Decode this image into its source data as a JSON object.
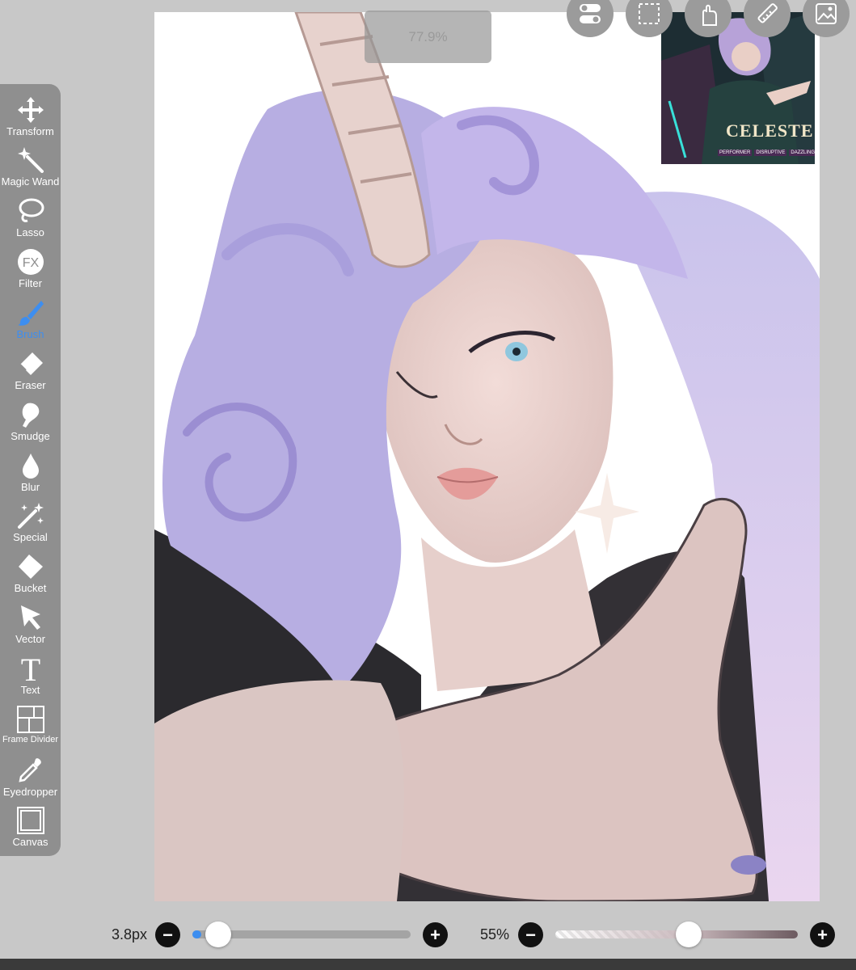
{
  "zoom": {
    "level": "77.9%"
  },
  "toolbar": {
    "active": "Brush",
    "tools": [
      {
        "id": "transform",
        "label": "Transform",
        "icon": "move-arrows-icon"
      },
      {
        "id": "magic-wand",
        "label": "Magic Wand",
        "icon": "magic-wand-icon"
      },
      {
        "id": "lasso",
        "label": "Lasso",
        "icon": "lasso-icon"
      },
      {
        "id": "filter",
        "label": "Filter",
        "icon": "fx-icon"
      },
      {
        "id": "brush",
        "label": "Brush",
        "icon": "brush-icon"
      },
      {
        "id": "eraser",
        "label": "Eraser",
        "icon": "eraser-icon"
      },
      {
        "id": "smudge",
        "label": "Smudge",
        "icon": "smudge-finger-icon"
      },
      {
        "id": "blur",
        "label": "Blur",
        "icon": "droplet-icon"
      },
      {
        "id": "special",
        "label": "Special",
        "icon": "sparkle-wand-icon"
      },
      {
        "id": "bucket",
        "label": "Bucket",
        "icon": "bucket-icon"
      },
      {
        "id": "vector",
        "label": "Vector",
        "icon": "cursor-arrow-icon"
      },
      {
        "id": "text",
        "label": "Text",
        "icon": "text-t-icon"
      },
      {
        "id": "frame-divider",
        "label": "Frame Divider",
        "icon": "frame-divider-icon"
      },
      {
        "id": "eyedropper",
        "label": "Eyedropper",
        "icon": "eyedropper-icon"
      },
      {
        "id": "canvas",
        "label": "Canvas",
        "icon": "canvas-square-icon"
      }
    ]
  },
  "top_tools": [
    "toggle-icon",
    "selection-marquee-icon",
    "hand-gesture-icon",
    "ruler-icon",
    "layers-icon"
  ],
  "reference": {
    "title": "CELESTE",
    "tags": [
      "PERFORMER",
      "DISRUPTIVE",
      "DAZZLING"
    ]
  },
  "brush_size": {
    "label": "3.8px",
    "value": 0.04
  },
  "opacity": {
    "label": "55%",
    "value": 0.55
  },
  "colors": {
    "accent": "#3d8ef0",
    "toolbar": "#8f8f8f",
    "background": "#c8c8c8"
  }
}
